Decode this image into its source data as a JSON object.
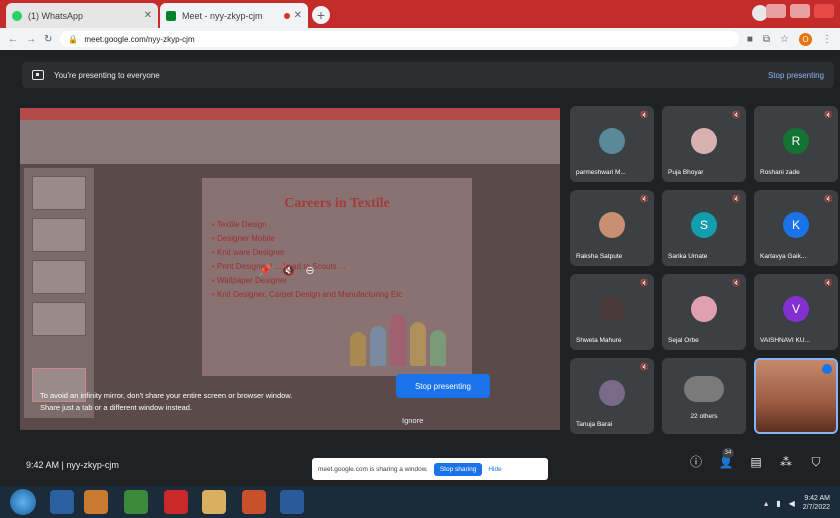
{
  "browser": {
    "tabs": [
      {
        "label": "(1) WhatsApp",
        "active": false
      },
      {
        "label": "Meet - nyy-zkyp-cjm",
        "active": true
      }
    ],
    "url": "meet.google.com/nyy-zkyp-cjm",
    "profile_initial": "O"
  },
  "banner": {
    "text": "You're presenting to everyone",
    "stop_link": "Stop presenting"
  },
  "slide": {
    "title": "Careers in Textile",
    "bullets": [
      "Textile Design",
      "Designer Mobile",
      "Knit ware Designer",
      "Print Designer / ... Lead to Scouts ...",
      "Wallpaper Designer",
      "Knit Designer, Carpet Design and Manufacturing Etc"
    ]
  },
  "warning": {
    "line1": "To avoid an infinity mirror, don't share your entire screen or browser window.",
    "line2": "Share just a tab or a different window instead."
  },
  "stop_presenting_button": "Stop presenting",
  "ignore_label": "Ignore",
  "participants": [
    {
      "name": "parmeshwari M...",
      "initial": "",
      "color": "#5a8a9a"
    },
    {
      "name": "Puja Bhoyar",
      "initial": "",
      "color": "#d8b0b0"
    },
    {
      "name": "Roshani zade",
      "initial": "R",
      "color": "#137333"
    },
    {
      "name": "Raksha Satpute",
      "initial": "",
      "color": "#c89070"
    },
    {
      "name": "Sarika Umate",
      "initial": "S",
      "color": "#129eaf"
    },
    {
      "name": "Kartavya Gaik...",
      "initial": "K",
      "color": "#1a73e8"
    },
    {
      "name": "Shweta Mahure",
      "initial": "",
      "color": "#4a3a3a"
    },
    {
      "name": "Sejal Orbe",
      "initial": "",
      "color": "#e0a0b0"
    },
    {
      "name": "VAISHNAVI KU...",
      "initial": "V",
      "color": "#8430ce"
    },
    {
      "name": "Tanuja Barai",
      "initial": "",
      "color": "#7a6a8a"
    }
  ],
  "others_tile": {
    "label": "22 others"
  },
  "meeting": {
    "time": "9:42 AM",
    "code": "nyy-zkyp-cjm",
    "people_count": "34"
  },
  "share_notice": {
    "text": "meet.google.com is sharing a window.",
    "stop_label": "Stop sharing",
    "hide_label": "Hide"
  },
  "taskbar": {
    "time": "9:42 AM",
    "date": "2/7/2022"
  },
  "icons": {
    "mic_off": "mic-off-icon",
    "info": "info-icon",
    "people": "people-icon",
    "chat": "chat-icon",
    "activities": "activities-icon",
    "host_controls": "shield-icon"
  }
}
